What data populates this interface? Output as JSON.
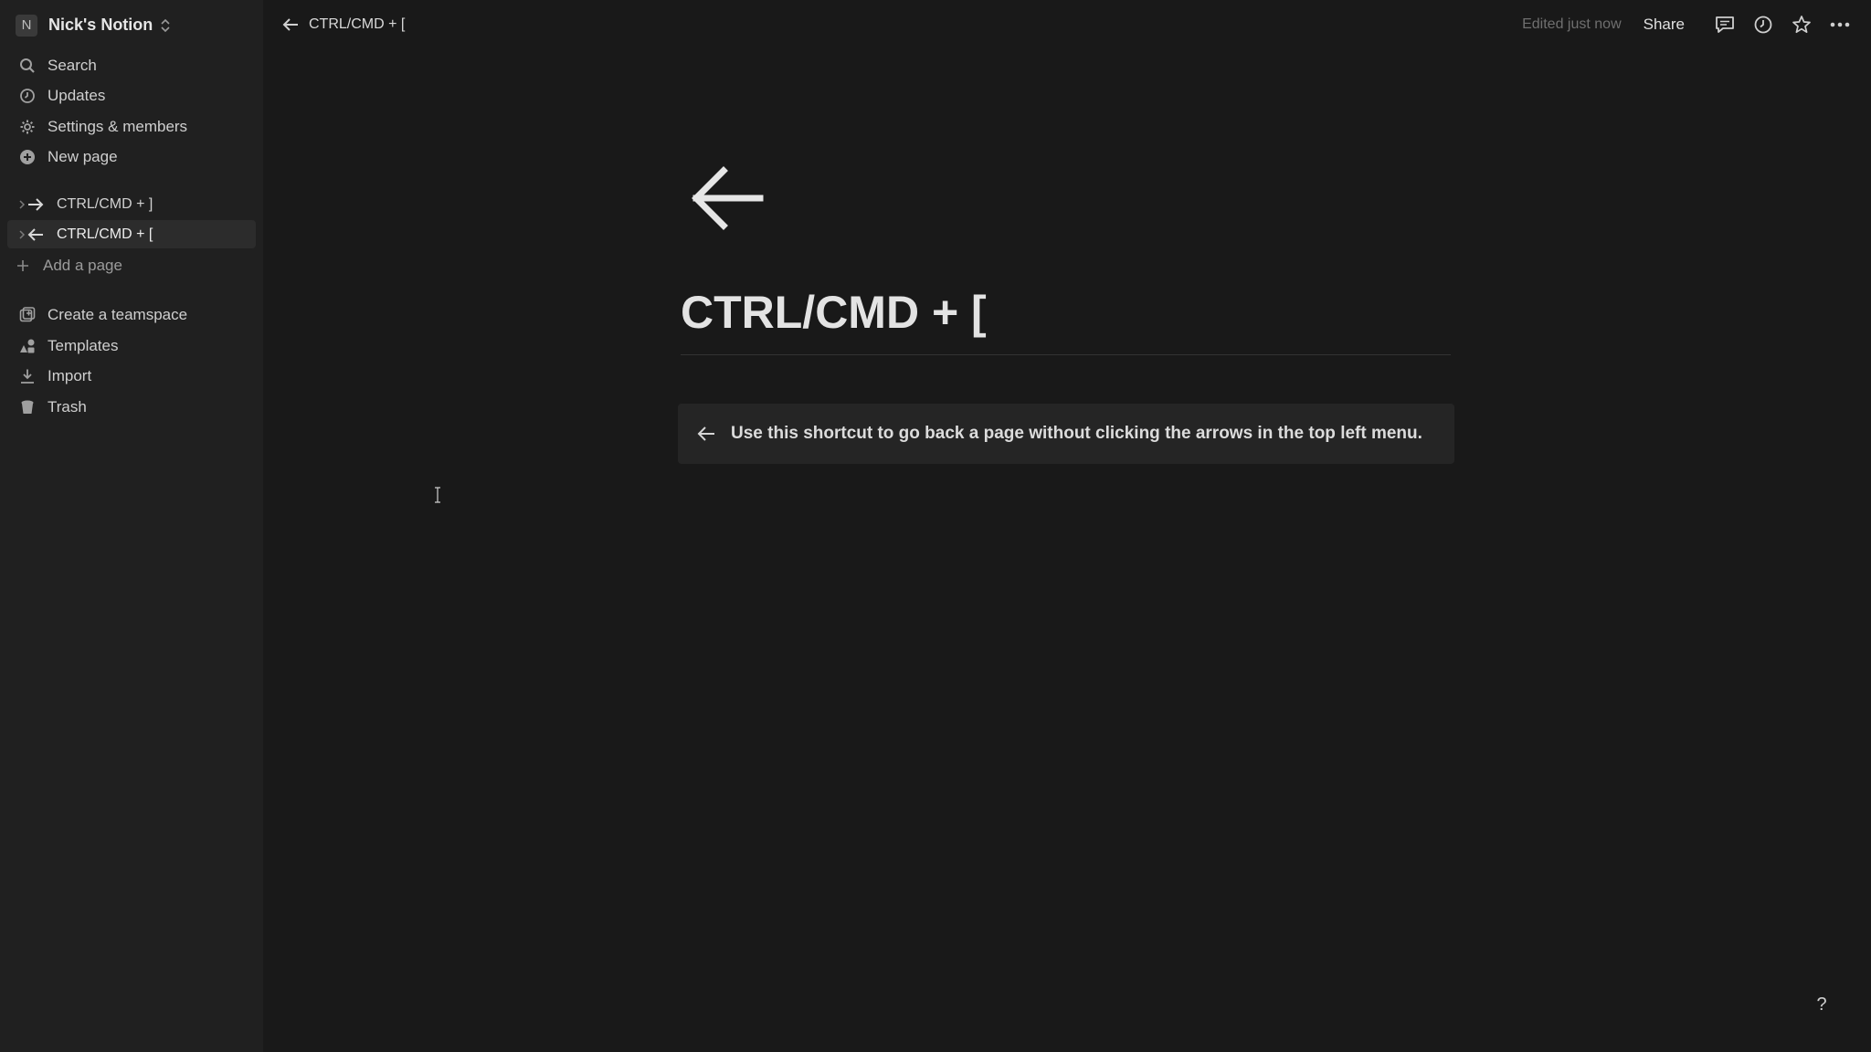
{
  "workspace": {
    "badge": "N",
    "name": "Nick's Notion"
  },
  "sidebar": {
    "nav": [
      {
        "label": "Search",
        "icon": "search-icon"
      },
      {
        "label": "Updates",
        "icon": "clock-icon"
      },
      {
        "label": "Settings & members",
        "icon": "gear-icon"
      },
      {
        "label": "New page",
        "icon": "plus-circle-icon"
      }
    ],
    "pages": [
      {
        "label": "CTRL/CMD + ]",
        "icon": "arrow-right-icon",
        "active": false
      },
      {
        "label": "CTRL/CMD + [",
        "icon": "arrow-left-icon",
        "active": true
      }
    ],
    "add_page": "Add a page",
    "tools": [
      {
        "label": "Create a teamspace",
        "icon": "teamspace-icon"
      },
      {
        "label": "Templates",
        "icon": "templates-icon"
      },
      {
        "label": "Import",
        "icon": "import-icon"
      },
      {
        "label": "Trash",
        "icon": "trash-icon"
      }
    ]
  },
  "topbar": {
    "breadcrumb": "CTRL/CMD + [",
    "edited": "Edited just now",
    "share": "Share"
  },
  "page": {
    "title": "CTRL/CMD + [",
    "callout": "Use this shortcut to go back a page without clicking the arrows in the top left menu."
  },
  "help": "?",
  "colors": {
    "background": "#191919",
    "sidebar": "#202020",
    "callout": "#252525"
  }
}
